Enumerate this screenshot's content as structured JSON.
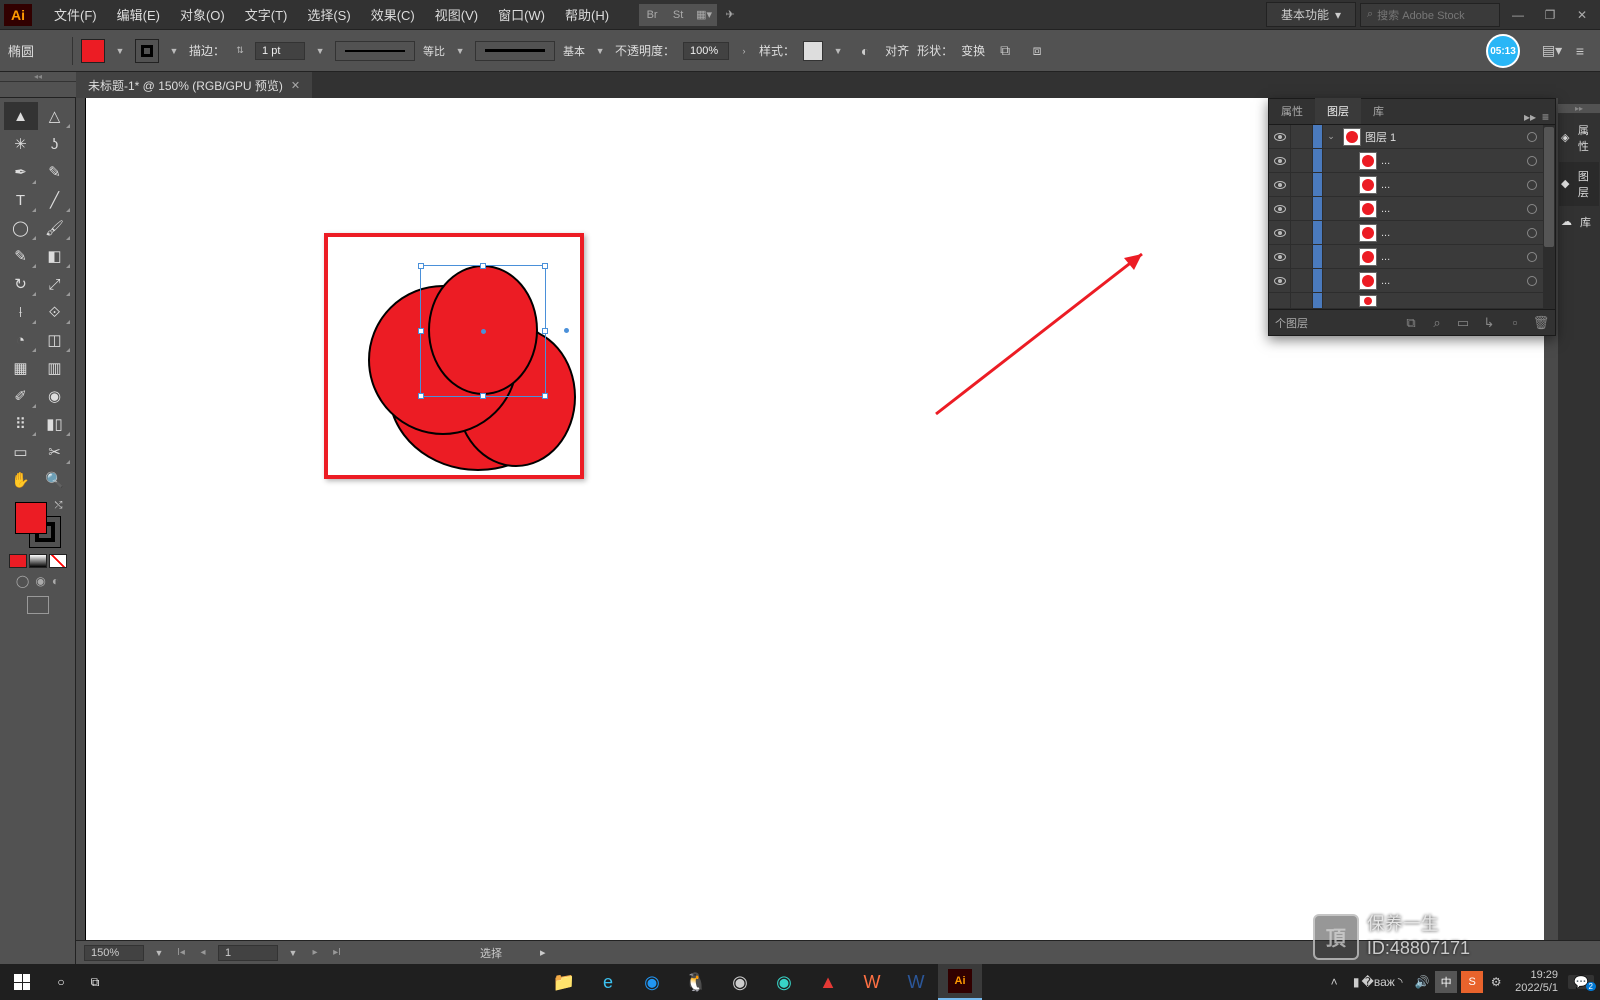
{
  "menubar": {
    "logo": "Ai",
    "items": [
      "文件(F)",
      "编辑(E)",
      "对象(O)",
      "文字(T)",
      "选择(S)",
      "效果(C)",
      "视图(V)",
      "窗口(W)",
      "帮助(H)"
    ],
    "workspace": "基本功能",
    "search_placeholder": "搜索 Adobe Stock",
    "br_label": "Br",
    "st_label": "St"
  },
  "options": {
    "tool_name": "椭圆",
    "stroke_label": "描边：",
    "stroke_weight": "1 pt",
    "profile_label": "等比",
    "brush_label": "基本",
    "opacity_label": "不透明度：",
    "opacity_value": "100%",
    "style_label": "样式：",
    "align_label": "对齐",
    "shape_label": "形状：",
    "transform_label": "变换",
    "timer": "05:13"
  },
  "doctab": {
    "title": "未标题-1* @ 150% (RGB/GPU 预览)"
  },
  "statusbar": {
    "zoom": "150%",
    "artboard": "1",
    "mode": "选择"
  },
  "layers_panel": {
    "tabs": [
      "属性",
      "图层",
      "库"
    ],
    "parent_layer": "图层 1",
    "sublayer_label": "...",
    "footer_count": "个图层"
  },
  "dock": {
    "properties": "属性",
    "layers": "图层",
    "libraries": "库"
  },
  "taskbar": {
    "time": "19:29",
    "date": "2022/5/1",
    "ime": "中",
    "notif_count": "2"
  },
  "watermark": {
    "logo": "頂",
    "line1": "保养一生",
    "line2": "ID:48807171"
  }
}
